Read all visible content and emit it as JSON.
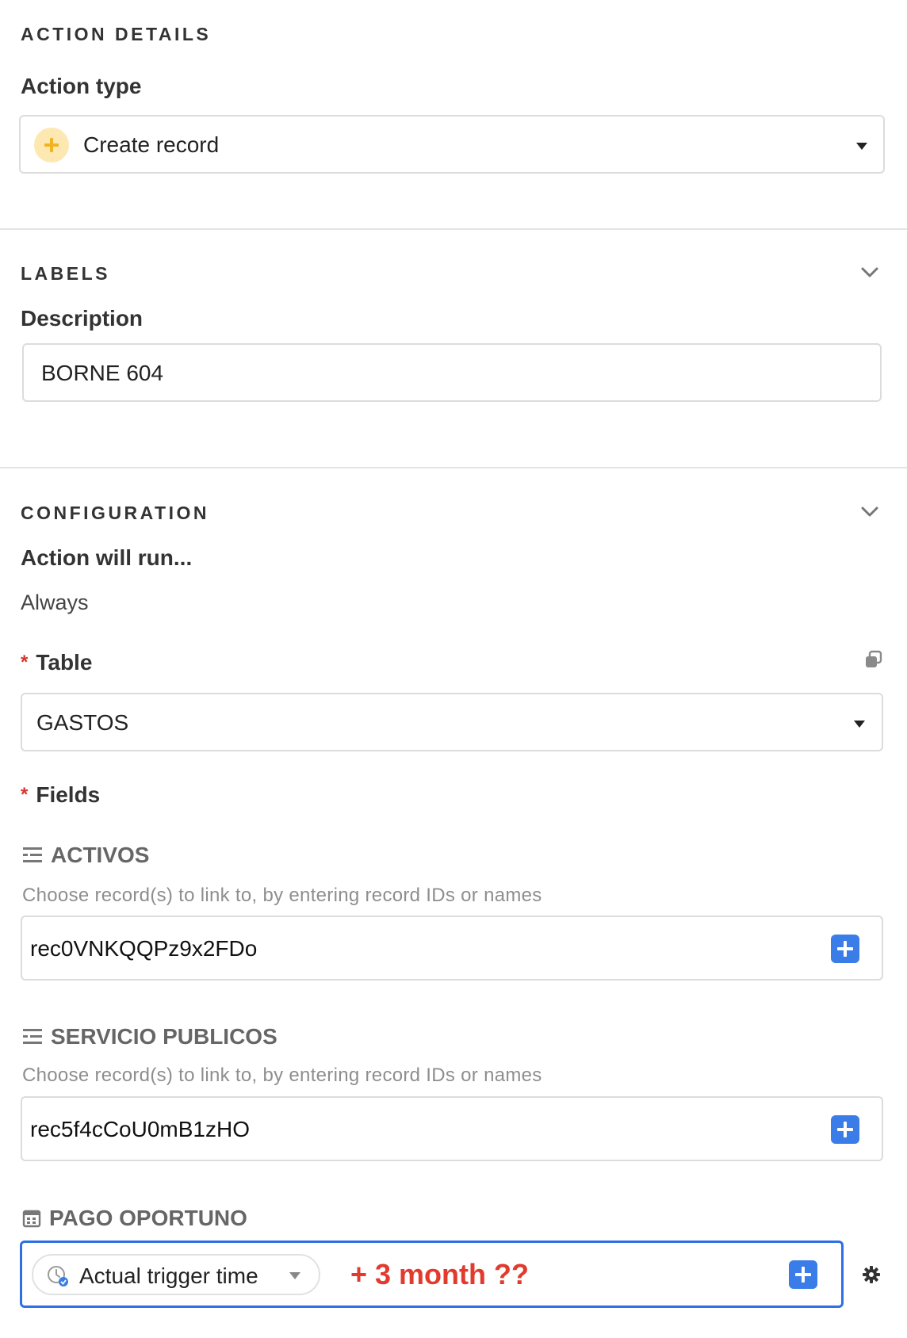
{
  "action_details": {
    "section_title": "ACTION DETAILS",
    "action_type_label": "Action type",
    "action_type_value": "Create record",
    "action_type_icon": "plus-circle-icon",
    "accent_color": "#f5b82e"
  },
  "labels": {
    "section_title": "LABELS",
    "description_label": "Description",
    "description_value": "BORNE 604"
  },
  "configuration": {
    "section_title": "CONFIGURATION",
    "run_label": "Action will run...",
    "run_value": "Always",
    "table_label": "Table",
    "table_value": "GASTOS",
    "fields_label": "Fields",
    "required_marker": "*",
    "fields": [
      {
        "name": "ACTIVOS",
        "icon": "linked-record-icon",
        "hint": "Choose record(s) to link to, by entering record IDs or names",
        "value": "rec0VNKQQPz9x2FDo"
      },
      {
        "name": "SERVICIO PUBLICOS",
        "icon": "linked-record-icon",
        "hint": "Choose record(s) to link to, by entering record IDs or names",
        "value": "rec5f4cCoU0mB1zHO"
      },
      {
        "name": "PAGO OPORTUNO",
        "icon": "calendar-icon",
        "token_label": "Actual trigger time",
        "annotation": "+ 3 month ??"
      }
    ]
  },
  "colors": {
    "focus_border": "#2f6fe4",
    "plus_button": "#3b7de8",
    "required": "#d8342c",
    "annotation": "#e23b2e"
  }
}
